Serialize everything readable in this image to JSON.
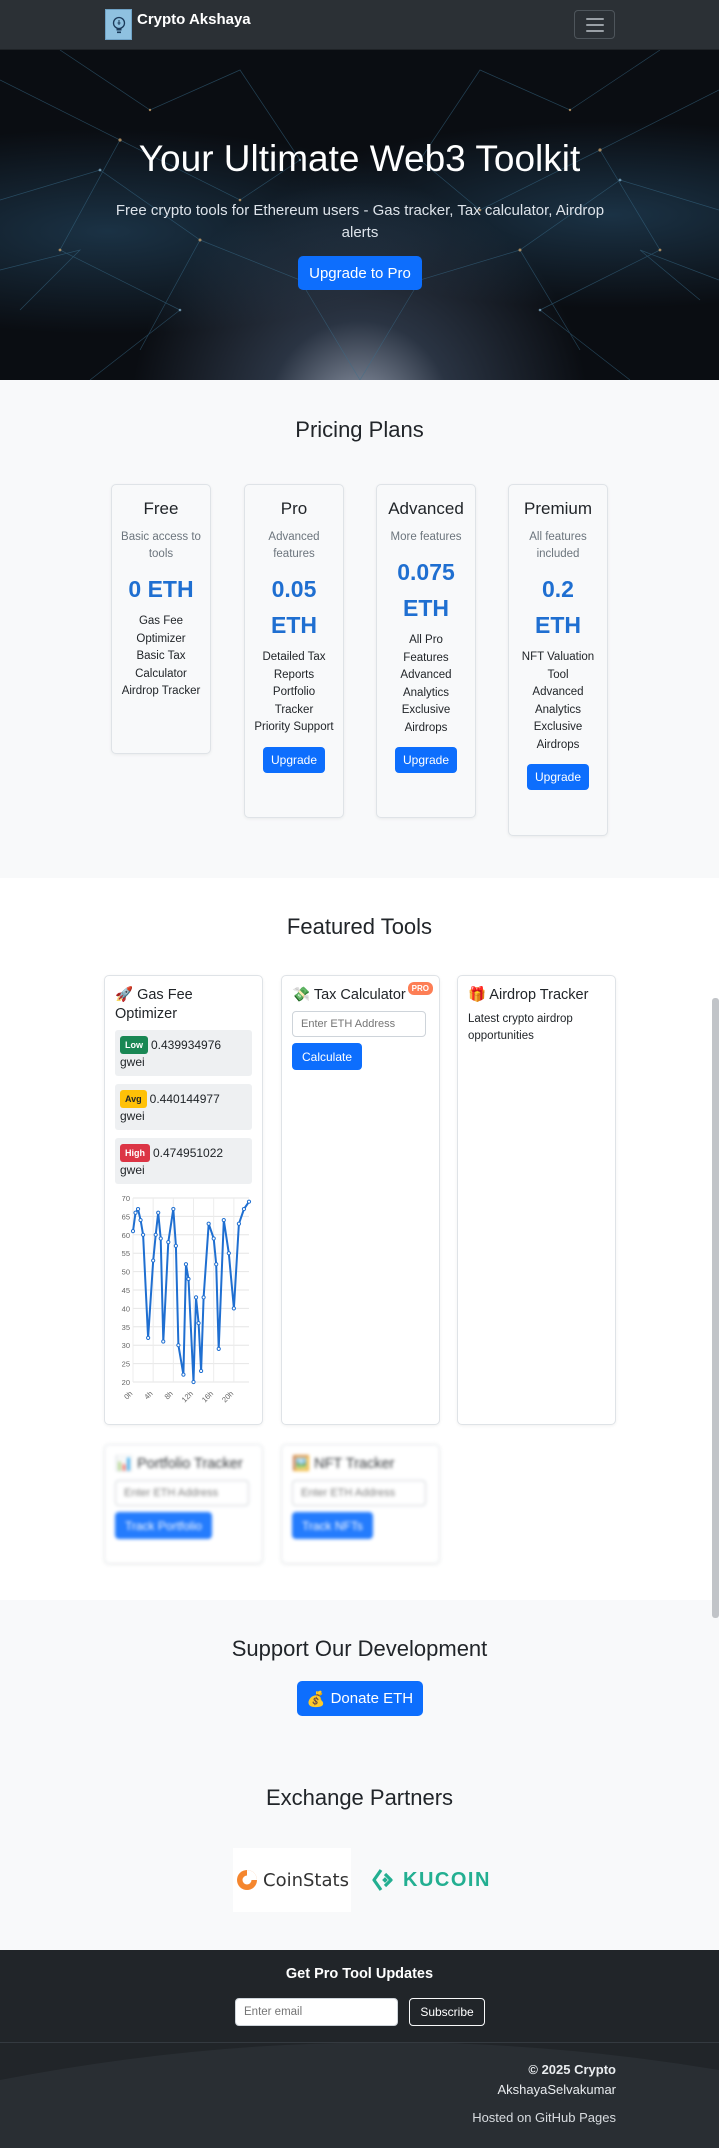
{
  "navbar": {
    "brand": "Crypto Akshaya",
    "logo_icon": "lightbulb-icon",
    "menu_icon": "hamburger-icon"
  },
  "hero": {
    "title": "Your Ultimate Web3 Toolkit",
    "subtitle": "Free crypto tools for Ethereum users - Gas tracker, Tax calculator, Airdrop alerts",
    "cta": "Upgrade to Pro"
  },
  "pricing": {
    "title": "Pricing Plans",
    "plans": [
      {
        "name": "Free",
        "desc": "Basic access to tools",
        "price": "0 ETH",
        "features": [
          "Gas Fee Optimizer",
          "Basic Tax Calculator",
          "Airdrop Tracker"
        ],
        "button": ""
      },
      {
        "name": "Pro",
        "desc": "Advanced features",
        "price": "0.05 ETH",
        "features": [
          "Detailed Tax Reports",
          "Portfolio Tracker",
          "Priority Support"
        ],
        "button": "Upgrade"
      },
      {
        "name": "Advanced",
        "desc": "More features",
        "price": "0.075 ETH",
        "features": [
          "All Pro Features",
          "Advanced Analytics",
          "Exclusive Airdrops"
        ],
        "button": "Upgrade"
      },
      {
        "name": "Premium",
        "desc": "All features included",
        "price": "0.2 ETH",
        "features": [
          "NFT Valuation Tool",
          "Advanced Analytics",
          "Exclusive Airdrops"
        ],
        "button": "Upgrade"
      }
    ]
  },
  "tools": {
    "title": "Featured Tools",
    "gas": {
      "title": "Gas Fee Optimizer",
      "icon": "rocket-icon",
      "low_label": "Low",
      "low_value": "0.439934976",
      "low_unit": "gwei",
      "avg_label": "Avg",
      "avg_value": "0.440144977",
      "avg_unit": "gwei",
      "high_label": "High",
      "high_value": "0.474951022",
      "high_unit": "gwei"
    },
    "tax": {
      "title": "Tax Calculator",
      "icon": "money-wings-icon",
      "badge": "PRO",
      "placeholder": "Enter ETH Address",
      "button": "Calculate"
    },
    "airdrop": {
      "title": "Airdrop Tracker",
      "icon": "gift-icon",
      "desc": "Latest crypto airdrop opportunities"
    },
    "portfolio": {
      "title": "Portfolio Tracker",
      "icon": "bar-chart-icon",
      "placeholder": "Enter ETH Address",
      "button": "Track Portfolio"
    },
    "nft": {
      "title": "NFT Tracker",
      "icon": "framed-picture-icon",
      "placeholder": "Enter ETH Address",
      "button": "Track NFTs"
    }
  },
  "chart_data": {
    "type": "line",
    "title": "",
    "xlabel": "",
    "ylabel": "",
    "ylim": [
      20,
      70
    ],
    "yticks": [
      20,
      25,
      30,
      35,
      40,
      45,
      50,
      55,
      60,
      65,
      70
    ],
    "xticks": [
      "0h",
      "4h",
      "8h",
      "12h",
      "16h",
      "20h"
    ],
    "xlim": [
      0,
      23
    ],
    "grid": true,
    "color": "#1f6fd1",
    "series": [
      {
        "x": [
          0,
          0.5,
          1,
          1.5,
          2,
          3,
          4,
          4.5,
          5,
          5.5,
          6,
          7,
          8,
          8.5,
          9,
          10,
          10.5,
          11,
          12,
          12.5,
          13,
          13.5,
          14,
          15,
          16,
          16.5,
          17,
          18,
          19,
          20,
          21,
          22,
          23
        ],
        "values": [
          61,
          66,
          67,
          64,
          60,
          32,
          53,
          60,
          66,
          59,
          31,
          58,
          67,
          57,
          30,
          22,
          52,
          48,
          20,
          43,
          36,
          23,
          43,
          63,
          59,
          52,
          29,
          64,
          55,
          40,
          63,
          67,
          69
        ]
      }
    ]
  },
  "support": {
    "title": "Support Our Development",
    "button": "Donate ETH",
    "button_icon": "money-bag-icon"
  },
  "partners": {
    "title": "Exchange Partners",
    "coinstats": "CoinStats",
    "kucoin": "KUCOIN"
  },
  "footer": {
    "title": "Get Pro Tool Updates",
    "email_placeholder": "Enter email",
    "subscribe": "Subscribe",
    "copyright_1": "© 2025 Crypto",
    "copyright_2": "AkshayaSelvakumar",
    "hosted": "Hosted on GitHub Pages"
  },
  "colors": {
    "primary": "#0d6efd",
    "navbar": "#2b3035",
    "footer": "#212529",
    "price": "#1f6fd1",
    "kucoin": "#23af91",
    "coinstats_orange": "#f5862e"
  }
}
